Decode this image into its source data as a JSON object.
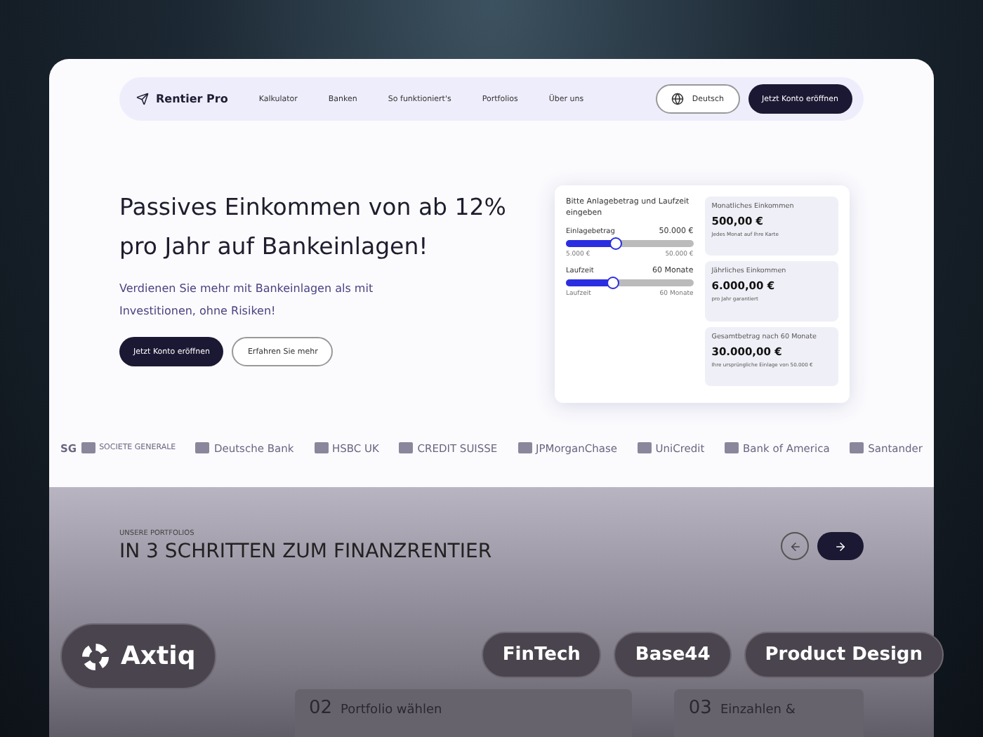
{
  "nav": {
    "brand": "Rentier Pro",
    "links": [
      "Kalkulator",
      "Banken",
      "So funktioniert's",
      "Portfolios",
      "Über uns"
    ],
    "language": "Deutsch",
    "cta": "Jetzt Konto eröffnen"
  },
  "hero": {
    "title": "Passives Einkommen von ab 12% pro Jahr auf Bankeinlagen!",
    "subtitle": "Verdienen Sie mehr mit Bankeinlagen als mit Investitionen, ohne Risiken!",
    "primary": "Jetzt Konto eröffnen",
    "secondary": "Erfahren Sie mehr"
  },
  "calculator": {
    "title": "Bitte Anlagebetrag und Laufzeit eingeben",
    "sliders": [
      {
        "label": "Einlagebetrag",
        "value": "50.000 €",
        "level": 0.4,
        "min": "5.000 €",
        "max": "50.000 €"
      },
      {
        "label": "Laufzeit",
        "value": "60 Monate",
        "level": 0.38,
        "min": "Laufzeit",
        "max": "60 Monate"
      }
    ],
    "results": [
      {
        "label": "Monatliches Einkommen",
        "amount": "500,00 €",
        "note": "Jedes Monat auf Ihre Karte"
      },
      {
        "label": "Jährliches Einkommen",
        "amount": "6.000,00 €",
        "note": "pro Jahr garantiert"
      },
      {
        "label": "Gesamtbetrag nach 60 Monate",
        "amount": "30.000,00 €",
        "note": "Ihre ursprüngliche Einlage von 50.000 €"
      }
    ]
  },
  "banks": [
    {
      "name": "SG",
      "sub": "SOCIETE GENERALE"
    },
    {
      "name": "Deutsche Bank"
    },
    {
      "name": "HSBC UK"
    },
    {
      "name": "CREDIT SUISSE"
    },
    {
      "name": "JPMorganChase"
    },
    {
      "name": "UniCredit"
    },
    {
      "name": "Bank of America"
    },
    {
      "name": "Santander"
    }
  ],
  "portfolios": {
    "eyebrow": "UNSERE PORTFOLIOS",
    "title": "IN 3 SCHRITTEN ZUM FINANZRENTIER",
    "arrows": [
      {
        "selected": false
      },
      {
        "selected": true
      }
    ],
    "steps": [
      {
        "number": "02",
        "title": "Portfolio wählen"
      },
      {
        "number": "03",
        "title": "Einzahlen &"
      }
    ]
  },
  "overlay": {
    "brand": "Axtiq",
    "tags": [
      "FinTech",
      "Base44",
      "Product Design"
    ]
  }
}
